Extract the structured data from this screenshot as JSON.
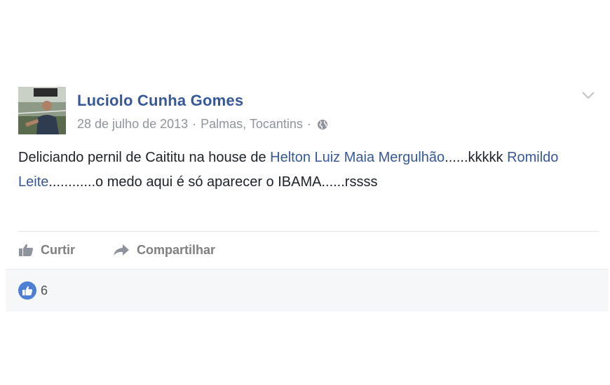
{
  "post": {
    "author": {
      "name": "Luciolo Cunha Gomes"
    },
    "meta": {
      "date": "28 de julho de 2013",
      "separator1": "·",
      "location": "Palmas, Tocantins",
      "separator2": "·",
      "privacy_icon": "globe-icon"
    },
    "options_icon": "chevron-down-icon",
    "content": {
      "part1": "Deliciando pernil de Caititu na house de ",
      "mention1": "Helton Luiz Maia Mergulhão",
      "part2": "......kkkkk ",
      "mention2": "Romildo Leite",
      "part3": "............o medo aqui é só aparecer o IBAMA......rssss"
    },
    "actions": {
      "like": {
        "label": "Curtir",
        "icon": "thumbs-up-icon"
      },
      "share": {
        "label": "Compartilhar",
        "icon": "share-arrow-icon"
      }
    },
    "reactions": {
      "icon": "like-reaction-icon",
      "count": "6"
    }
  },
  "colors": {
    "link": "#365899",
    "meta_text": "#90949c",
    "action_text": "#7f7f7f",
    "like_badge": "#4e7fd6",
    "footer_bg": "#f6f7f9"
  }
}
